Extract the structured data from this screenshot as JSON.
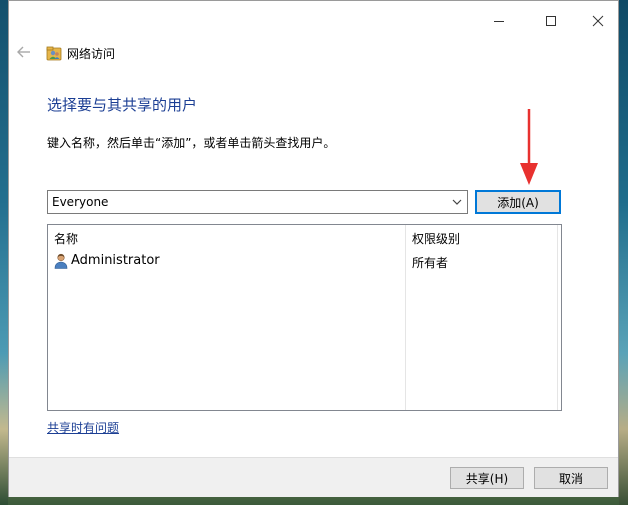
{
  "window": {
    "title": "网络访问",
    "controls": {
      "minimize": "minimize-icon",
      "maximize": "maximize-icon",
      "close": "close-icon"
    }
  },
  "page": {
    "heading": "选择要与其共享的用户",
    "instruction": "键入名称，然后单击“添加”，或者单击箭头查找用户。"
  },
  "user_entry": {
    "value": "Everyone",
    "add_label": "添加(A)"
  },
  "table": {
    "columns": [
      "名称",
      "权限级别"
    ],
    "rows": [
      {
        "name": "Administrator",
        "level": "所有者",
        "icon": "user-icon"
      }
    ]
  },
  "help_link": "共享时有问题",
  "footer": {
    "share_label": "共享(H)",
    "cancel_label": "取消"
  },
  "colors": {
    "accent": "#0078d7",
    "heading": "#1c3f94",
    "annotation": "#e8312f"
  }
}
